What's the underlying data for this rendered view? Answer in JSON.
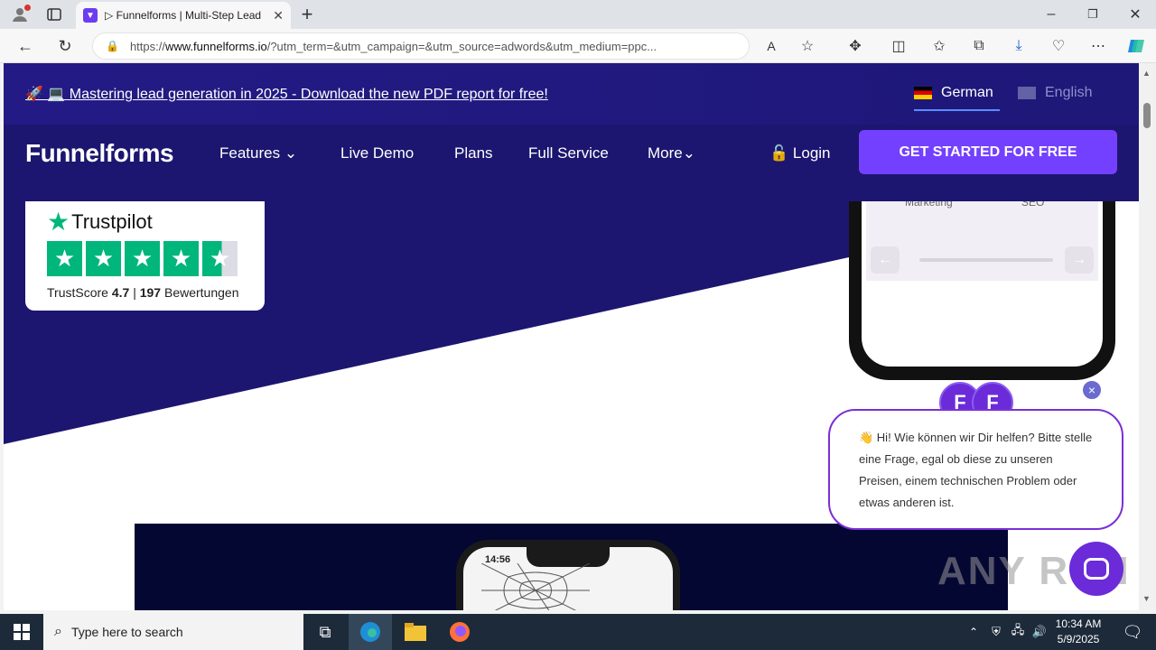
{
  "browser": {
    "tab_title": "▷ Funnelforms | Multi-Step Lead",
    "url_prefix": "https://",
    "url_domain": "www.funnelforms.io",
    "url_rest": "/?utm_term=&utm_campaign=&utm_source=adwords&utm_medium=ppc..."
  },
  "announcement": {
    "text": "🚀 💻 Mastering lead generation in 2025 - Download the new PDF report for free!",
    "lang_german": "German",
    "lang_english": "English"
  },
  "nav": {
    "logo": "Funnelforms",
    "features": "Features",
    "live_demo": "Live Demo",
    "plans": "Plans",
    "full_service": "Full Service",
    "more": "More",
    "login": "Login",
    "cta": "GET STARTED FOR FREE"
  },
  "trustpilot": {
    "brand": "Trustpilot",
    "score_label": "TrustScore",
    "score": "4.7",
    "separator": "|",
    "count": "197",
    "reviews_label": "Bewertungen"
  },
  "phone_top": {
    "label_left": "Marketing",
    "label_right": "SEO"
  },
  "phone_bottom": {
    "time": "14:56"
  },
  "chat": {
    "message": "👋 Hi! Wie können wir Dir helfen? Bitte stelle eine Frage, egal ob diese zu unseren Preisen, einem technischen Problem oder etwas anderen ist.",
    "close": "×"
  },
  "watermark": "ANY RUN",
  "taskbar": {
    "search_placeholder": "Type here to search",
    "time": "10:34 AM",
    "date": "5/9/2025"
  },
  "colors": {
    "hero_bg": "#1c1670",
    "cta_bg": "#7440ff",
    "trustpilot_green": "#00b67a",
    "chat_purple": "#6b2bd9"
  }
}
